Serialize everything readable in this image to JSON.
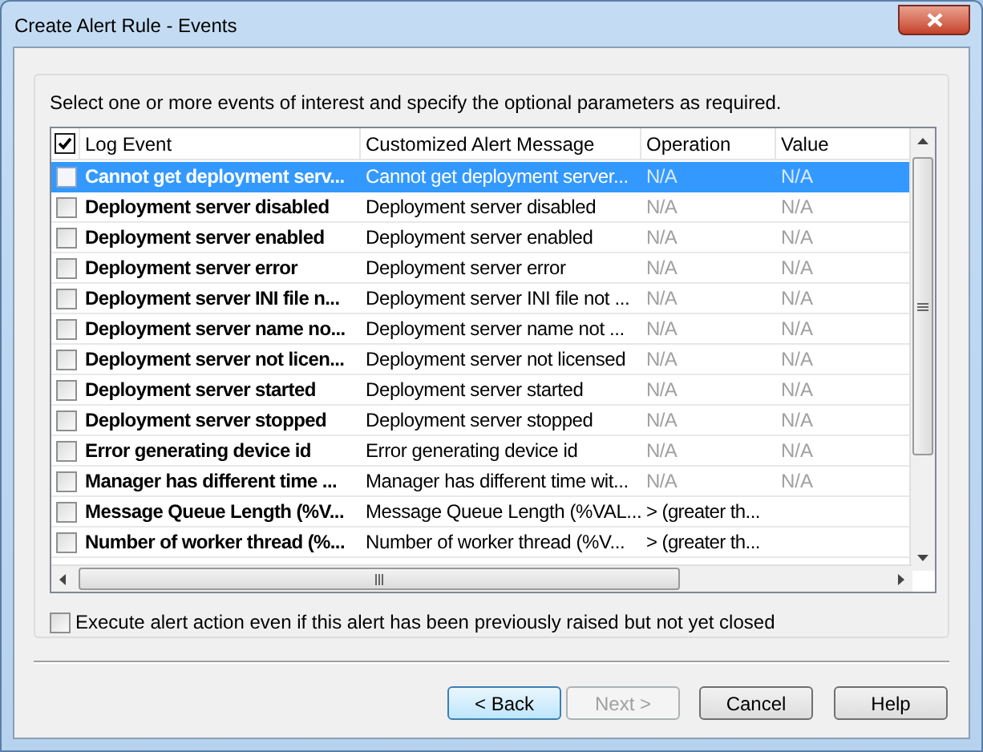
{
  "window": {
    "title": "Create Alert Rule - Events"
  },
  "instruction": "Select one or more events of interest and specify the optional parameters as required.",
  "table": {
    "select_all": {
      "checked": true
    },
    "columns": [
      "Log Event",
      "Customized Alert Message",
      "Operation",
      "Value"
    ],
    "rows": [
      {
        "event": "Cannot get deployment serv...",
        "message": "Cannot get deployment server...",
        "operation": "N/A",
        "value": "N/A",
        "params_disabled": true,
        "checked": false,
        "selected": true
      },
      {
        "event": "Deployment server disabled",
        "message": "Deployment server disabled",
        "operation": "N/A",
        "value": "N/A",
        "params_disabled": true,
        "checked": false,
        "selected": false
      },
      {
        "event": "Deployment server enabled",
        "message": "Deployment server enabled",
        "operation": "N/A",
        "value": "N/A",
        "params_disabled": true,
        "checked": false,
        "selected": false
      },
      {
        "event": "Deployment server error",
        "message": "Deployment server error",
        "operation": "N/A",
        "value": "N/A",
        "params_disabled": true,
        "checked": false,
        "selected": false
      },
      {
        "event": "Deployment server INI file n...",
        "message": "Deployment server INI file not ...",
        "operation": "N/A",
        "value": "N/A",
        "params_disabled": true,
        "checked": false,
        "selected": false
      },
      {
        "event": "Deployment server name no...",
        "message": "Deployment server name not ...",
        "operation": "N/A",
        "value": "N/A",
        "params_disabled": true,
        "checked": false,
        "selected": false
      },
      {
        "event": "Deployment server not licen...",
        "message": "Deployment server not licensed",
        "operation": "N/A",
        "value": "N/A",
        "params_disabled": true,
        "checked": false,
        "selected": false
      },
      {
        "event": "Deployment server started",
        "message": "Deployment server started",
        "operation": "N/A",
        "value": "N/A",
        "params_disabled": true,
        "checked": false,
        "selected": false
      },
      {
        "event": "Deployment server stopped",
        "message": "Deployment server stopped",
        "operation": "N/A",
        "value": "N/A",
        "params_disabled": true,
        "checked": false,
        "selected": false
      },
      {
        "event": "Error generating device id",
        "message": "Error generating device id",
        "operation": "N/A",
        "value": "N/A",
        "params_disabled": true,
        "checked": false,
        "selected": false
      },
      {
        "event": "Manager has different time ...",
        "message": "Manager has different time wit...",
        "operation": "N/A",
        "value": "N/A",
        "params_disabled": true,
        "checked": false,
        "selected": false
      },
      {
        "event": "Message Queue Length (%V...",
        "message": "Message Queue Length (%VAL...",
        "operation": "> (greater th...",
        "params_disabled": false,
        "checked": false,
        "selected": false
      },
      {
        "event": "Number of worker thread (%...",
        "message": "Number of worker thread (%V...",
        "operation": "> (greater th...",
        "params_disabled": false,
        "checked": false,
        "selected": false
      }
    ]
  },
  "option": {
    "label": "Execute alert action even if this alert has been previously raised but not yet closed",
    "checked": false
  },
  "buttons": [
    {
      "label": "< Back",
      "disabled": false,
      "default": true
    },
    {
      "label": "Next >",
      "disabled": true,
      "default": false
    },
    {
      "label": "Cancel",
      "disabled": false,
      "default": false
    },
    {
      "label": "Help",
      "disabled": false,
      "default": false
    }
  ]
}
